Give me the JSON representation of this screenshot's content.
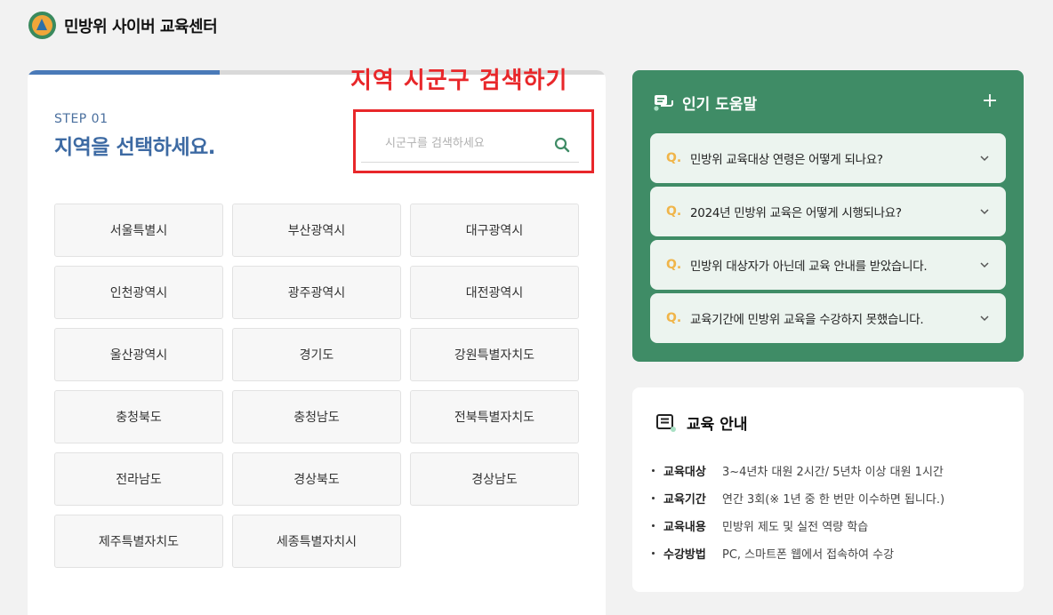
{
  "header": {
    "site_title": "민방위 사이버 교육센터"
  },
  "step": {
    "label": "STEP 01",
    "title": "지역을 선택하세요.",
    "progress_fraction": 0.333
  },
  "search": {
    "placeholder": "시군구를 검색하세요",
    "value": ""
  },
  "annotation": {
    "text": "지역 시군구 검색하기",
    "color": "#e8272a"
  },
  "regions": [
    "서울특별시",
    "부산광역시",
    "대구광역시",
    "인천광역시",
    "광주광역시",
    "대전광역시",
    "울산광역시",
    "경기도",
    "강원특별자치도",
    "충청북도",
    "충청남도",
    "전북특별자치도",
    "전라남도",
    "경상북도",
    "경상남도",
    "제주특별자치도",
    "세종특별자치시"
  ],
  "faq": {
    "title": "인기 도움말",
    "q_marker": "Q.",
    "items": [
      "민방위 교육대상 연령은 어떻게 되나요?",
      "2024년 민방위 교육은 어떻게 시행되나요?",
      "민방위 대상자가 아닌데 교육 안내를 받았습니다.",
      "교육기간에 민방위 교육을 수강하지 못했습니다."
    ]
  },
  "info": {
    "title": "교육 안내",
    "rows": [
      {
        "key": "교육대상",
        "value": "3~4년차 대원 2시간/ 5년차 이상 대원 1시간"
      },
      {
        "key": "교육기간",
        "value": "연간 3회(※ 1년 중 한 번만 이수하면 됩니다.)"
      },
      {
        "key": "교육내용",
        "value": "민방위 제도 및 실전 역량 학습"
      },
      {
        "key": "수강방법",
        "value": "PC, 스마트폰 웹에서 접속하여 수강"
      }
    ]
  },
  "colors": {
    "brand_green": "#3f8c66",
    "brand_blue": "#3d6aa3",
    "accent_yellow": "#f0b54a"
  },
  "icons": {
    "logo": "civil-defense-logo",
    "search": "search-icon",
    "faq": "chat-bubbles-icon",
    "plus": "plus-icon",
    "chevron": "chevron-down-icon",
    "info": "book-icon"
  }
}
